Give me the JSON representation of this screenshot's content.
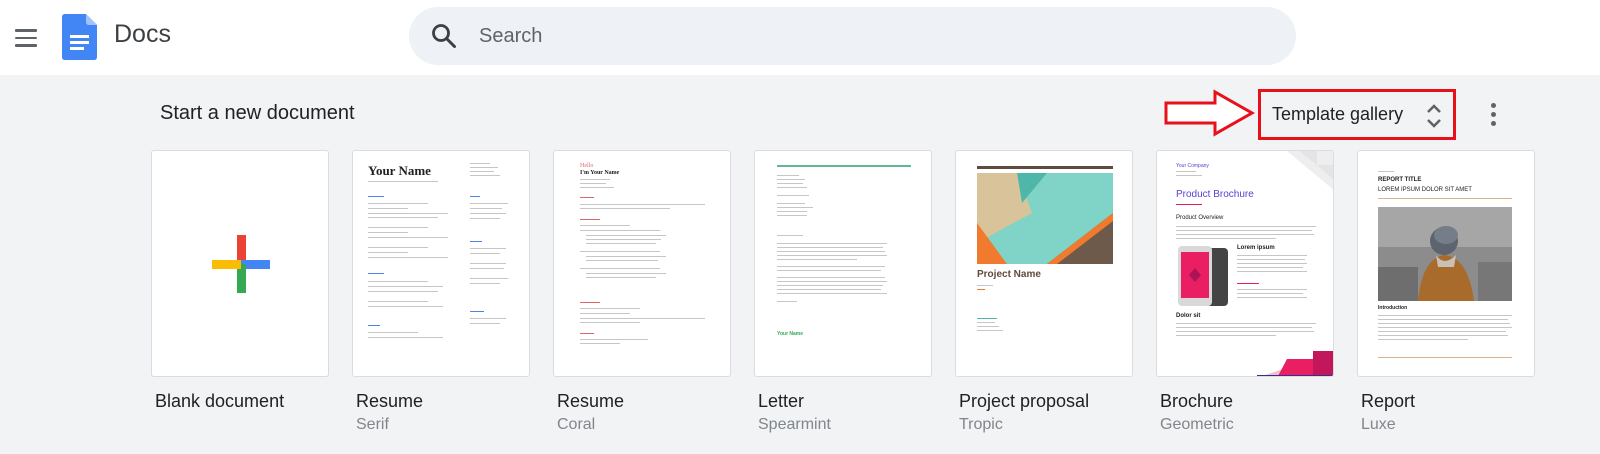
{
  "header": {
    "app_title": "Docs",
    "search_placeholder": "Search",
    "menu_icon": "menu-icon",
    "logo_icon": "docs-logo-icon"
  },
  "section": {
    "title": "Start a new document",
    "template_gallery_label": "Template gallery"
  },
  "templates": [
    {
      "name": "Blank document",
      "subtitle": ""
    },
    {
      "name": "Resume",
      "subtitle": "Serif",
      "heading": "Your Name"
    },
    {
      "name": "Resume",
      "subtitle": "Coral",
      "heading": "Hello\nI'm Your Name"
    },
    {
      "name": "Letter",
      "subtitle": "Spearmint",
      "signoff": "Your Name"
    },
    {
      "name": "Project proposal",
      "subtitle": "Tropic",
      "heading": "Project Name"
    },
    {
      "name": "Brochure",
      "subtitle": "Geometric",
      "company": "Your Company",
      "heading": "Product Brochure",
      "overview": "Product Overview",
      "lorem": "Lorem ipsum",
      "dolor": "Dolor sit"
    },
    {
      "name": "Report",
      "subtitle": "Luxe",
      "title": "REPORT TITLE",
      "subtitle2": "LOREM IPSUM DOLOR SIT AMET",
      "intro": "Introduction"
    }
  ],
  "colors": {
    "accent_red": "#e8101b",
    "google_blue": "#4285f4",
    "google_red": "#ea4335",
    "google_yellow": "#fbbc04",
    "google_green": "#34a853"
  }
}
